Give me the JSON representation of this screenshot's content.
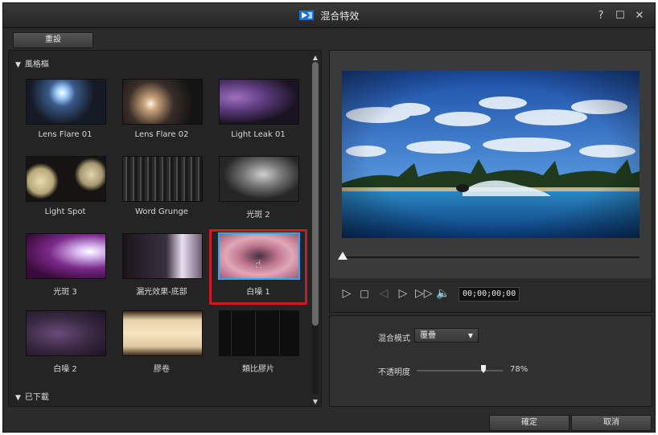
{
  "window": {
    "title": "混合特效",
    "controls": {
      "help": "?",
      "maximize": "☐",
      "close": "✕"
    }
  },
  "toolbar": {
    "reset_label": "重設"
  },
  "categories": {
    "style": "風格樞",
    "downloaded": "已下載"
  },
  "effects": [
    {
      "label": "Lens Flare 01",
      "icon": "lens-flare-thumbnail"
    },
    {
      "label": "Lens Flare 02",
      "icon": "lens-flare-thumbnail"
    },
    {
      "label": "Light Leak 01",
      "icon": "light-leak-thumbnail"
    },
    {
      "label": "Light Spot",
      "icon": "light-spot-thumbnail"
    },
    {
      "label": "Word Grunge",
      "icon": "grunge-thumbnail"
    },
    {
      "label": "光斑 2",
      "icon": "light-spot-thumbnail"
    },
    {
      "label": "光斑 3",
      "icon": "light-spot-thumbnail"
    },
    {
      "label": "漏光效果-底部",
      "icon": "light-leak-thumbnail"
    },
    {
      "label": "白噪 1",
      "icon": "noise-thumbnail",
      "selected": true
    },
    {
      "label": "白噪 2",
      "icon": "noise-thumbnail"
    },
    {
      "label": "膠卷",
      "icon": "film-thumbnail"
    },
    {
      "label": "類比膠片",
      "icon": "analog-film-thumbnail"
    }
  ],
  "player": {
    "timecode": "00;00;00;00",
    "position": 0
  },
  "settings": {
    "blend_mode_label": "混合模式",
    "blend_mode_value": "覆疊",
    "opacity_label": "不透明度",
    "opacity_value": "78%",
    "opacity": 0.78
  },
  "footer": {
    "ok_label": "確定",
    "cancel_label": "取消"
  },
  "colors": {
    "selection_border": "#2aa8ff",
    "highlight_box": "#d01a1a"
  }
}
